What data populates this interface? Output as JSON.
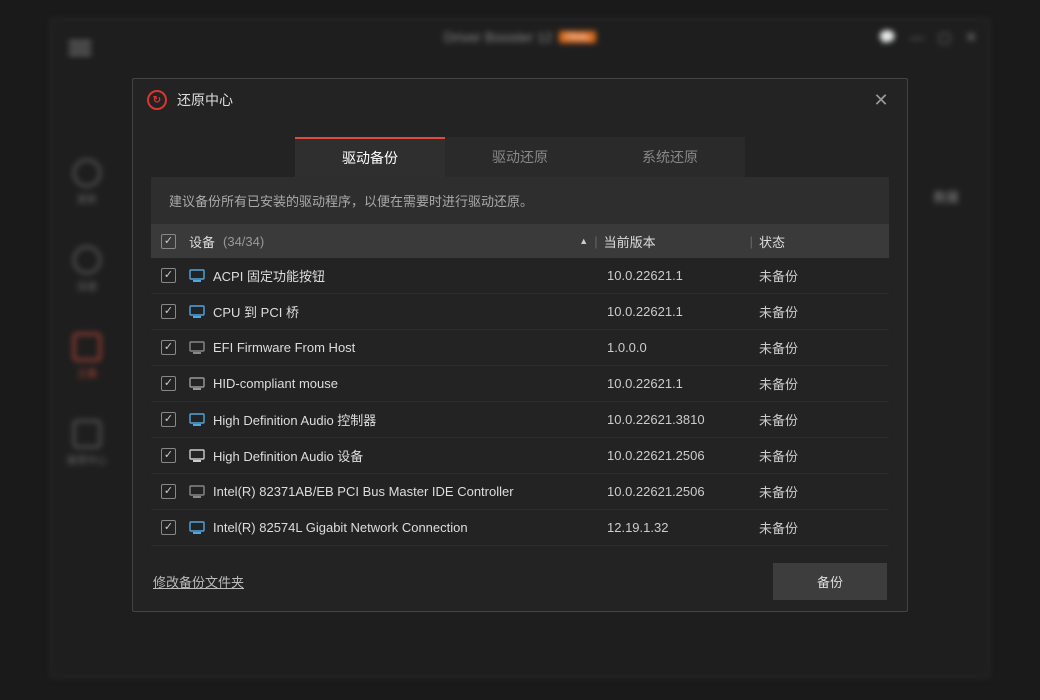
{
  "bg": {
    "title": "Driver Booster 12",
    "badge": "TRIAL",
    "sidebar": [
      {
        "label": "更新"
      },
      {
        "label": "加速"
      },
      {
        "label": "工具"
      },
      {
        "label": "推荐中心"
      }
    ],
    "rightBtn": "救援"
  },
  "modal": {
    "title": "还原中心",
    "tabs": [
      {
        "label": "驱动备份",
        "active": true
      },
      {
        "label": "驱动还原",
        "active": false
      },
      {
        "label": "系统还原",
        "active": false
      }
    ],
    "hint": "建议备份所有已安装的驱动程序，以便在需要时进行驱动还原。",
    "columns": {
      "device": "设备",
      "count": "(34/34)",
      "version": "当前版本",
      "status": "状态"
    },
    "rows": [
      {
        "checked": true,
        "iconColor": "#4fa7e0",
        "name": "ACPI 固定功能按钮",
        "version": "10.0.22621.1",
        "status": "未备份"
      },
      {
        "checked": true,
        "iconColor": "#4fa7e0",
        "name": "CPU 到 PCI 桥",
        "version": "10.0.22621.1",
        "status": "未备份"
      },
      {
        "checked": true,
        "iconColor": "#888888",
        "name": "EFI Firmware From Host",
        "version": "1.0.0.0",
        "status": "未备份"
      },
      {
        "checked": true,
        "iconColor": "#999999",
        "name": "HID-compliant mouse",
        "version": "10.0.22621.1",
        "status": "未备份"
      },
      {
        "checked": true,
        "iconColor": "#4fa7e0",
        "name": "High Definition Audio 控制器",
        "version": "10.0.22621.3810",
        "status": "未备份"
      },
      {
        "checked": true,
        "iconColor": "#cccccc",
        "name": "High Definition Audio 设备",
        "version": "10.0.22621.2506",
        "status": "未备份"
      },
      {
        "checked": true,
        "iconColor": "#888888",
        "name": "Intel(R) 82371AB/EB PCI Bus Master IDE Controller",
        "version": "10.0.22621.2506",
        "status": "未备份"
      },
      {
        "checked": true,
        "iconColor": "#4fa7e0",
        "name": "Intel(R) 82574L Gigabit Network Connection",
        "version": "12.19.1.32",
        "status": "未备份"
      }
    ],
    "footer": {
      "link": "修改备份文件夹",
      "button": "备份"
    }
  }
}
